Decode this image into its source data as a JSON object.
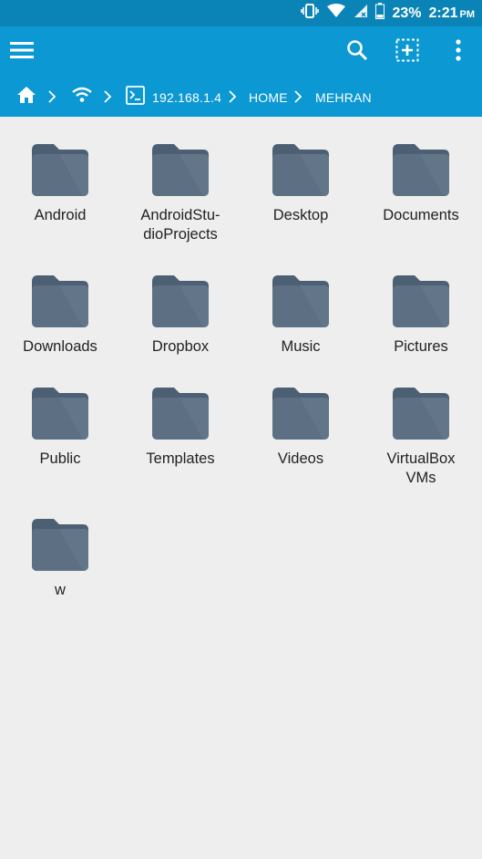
{
  "status_bar": {
    "battery_text": "23%",
    "time": "2:21",
    "ampm": "PM"
  },
  "app_bar": {
    "menu_icon": "hamburger-menu-icon",
    "search_icon": "search-icon",
    "select_icon": "select-all-icon",
    "overflow_icon": "more-vert-icon"
  },
  "breadcrumb": {
    "home_icon": "home-icon",
    "network_icon": "wifi-icon",
    "terminal_icon": "terminal-icon",
    "host": "192.168.1.4",
    "home": "HOME",
    "user": "MEHRAN"
  },
  "folders": [
    {
      "name": "Android"
    },
    {
      "name": "AndroidStu-\ndioProjects"
    },
    {
      "name": "Desktop"
    },
    {
      "name": "Documents"
    },
    {
      "name": "Downloads"
    },
    {
      "name": "Dropbox"
    },
    {
      "name": "Music"
    },
    {
      "name": "Pictures"
    },
    {
      "name": "Public"
    },
    {
      "name": "Templates"
    },
    {
      "name": "Videos"
    },
    {
      "name": "VirtualBox\nVMs"
    },
    {
      "name": "w"
    }
  ],
  "colors": {
    "status_bar": "#0a84b6",
    "app_bar": "#0b98d3",
    "folder": "#5d7083",
    "background": "#eeeeee"
  }
}
